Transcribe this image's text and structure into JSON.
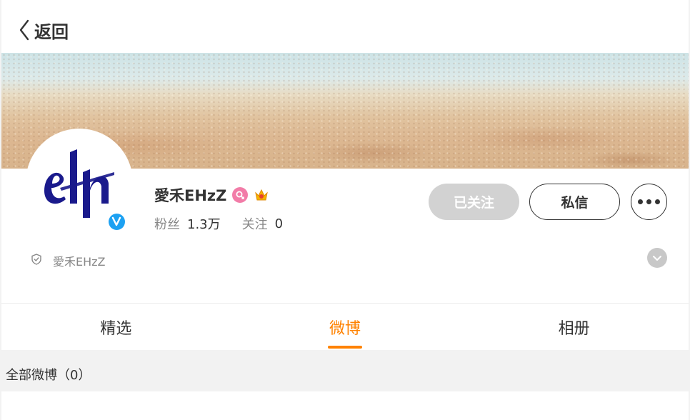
{
  "header": {
    "back_label": "返回",
    "back_icon": "chevron-left-icon"
  },
  "profile": {
    "username": "愛禾EHzZ",
    "avatar_text": "ehz",
    "gender_badge_icon": "female-icon",
    "vip_badge_icon": "crown-icon",
    "verified_icon": "verified-v-icon",
    "fans_label": "粉丝",
    "fans_count": "1.3万",
    "following_label": "关注",
    "following_count": "0",
    "description": "愛禾EHzZ",
    "description_icon": "shield-icon"
  },
  "actions": {
    "followed_label": "已关注",
    "message_label": "私信",
    "more_icon": "more-dots-icon",
    "expand_icon": "chevron-down-icon"
  },
  "tabs": [
    {
      "label": "精选",
      "active": false
    },
    {
      "label": "微博",
      "active": true
    },
    {
      "label": "相册",
      "active": false
    }
  ],
  "feed": {
    "section_label": "全部微博（0）"
  },
  "colors": {
    "accent": "#ff8200",
    "verified": "#1da1f2",
    "followed_button": "#d2d2d2",
    "female_badge": "#f27ca8"
  }
}
